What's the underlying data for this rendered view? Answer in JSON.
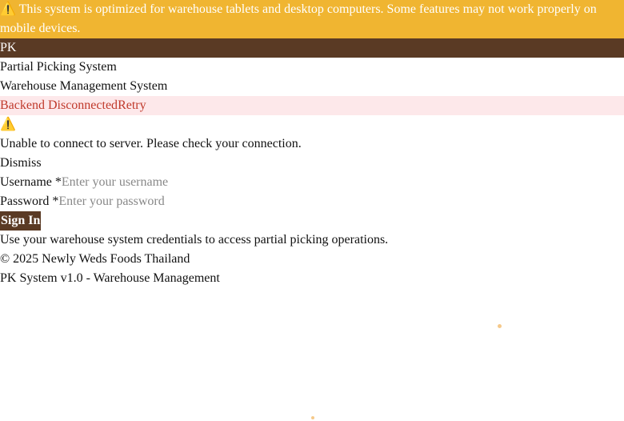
{
  "banner": {
    "icon": "warning-icon",
    "text": "This system is optimized for warehouse tablets and desktop computers. Some features may not work properly on mobile devices."
  },
  "brand": {
    "logo_text": "PK",
    "app_title": "Partial Picking System",
    "app_subtitle": "Warehouse Management System"
  },
  "status": {
    "text": "Backend Disconnected",
    "retry_label": "Retry"
  },
  "alert": {
    "icon": "warning-icon",
    "message": "Unable to connect to server. Please check your connection.",
    "dismiss_label": "Dismiss"
  },
  "form": {
    "username_label": "Username *",
    "username_placeholder": "Enter your username",
    "username_value": "",
    "password_label": "Password *",
    "password_placeholder": "Enter your password",
    "password_value": "",
    "signin_label": "Sign In",
    "help_text": "Use your warehouse system credentials to access partial picking operations."
  },
  "footer": {
    "copyright": "© 2025 Newly Weds Foods Thailand",
    "version": "PK System v1.0 - Warehouse Management"
  },
  "colors": {
    "banner": "#f0b531",
    "brand": "#5a3a24",
    "error_text": "#c0392b",
    "error_bg": "#fde8ea"
  }
}
